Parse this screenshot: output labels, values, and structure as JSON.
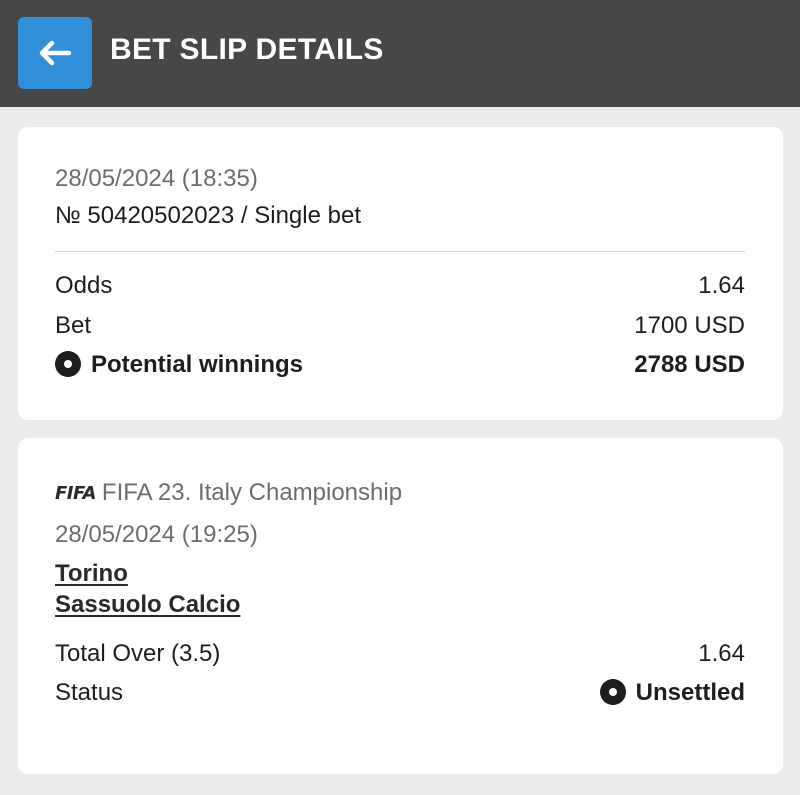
{
  "header": {
    "title": "BET SLIP DETAILS",
    "back_icon": "arrow-left-icon",
    "accent_color": "#2f8fd8",
    "bar_color": "#474747"
  },
  "summary": {
    "datetime": "28/05/2024 (18:35)",
    "ticket": "№ 50420502023 / Single bet",
    "odds_label": "Odds",
    "odds_value": "1.64",
    "bet_label": "Bet",
    "bet_value": "1700 USD",
    "winnings_label": "Potential winnings",
    "winnings_value": "2788 USD"
  },
  "event": {
    "league_logo": "FIFA",
    "league": "FIFA 23. Italy Championship",
    "datetime": "28/05/2024 (19:25)",
    "team_home": "Torino",
    "team_away": "Sassuolo Calcio",
    "market_label": "Total Over (3.5)",
    "market_odds": "1.64",
    "status_label": "Status",
    "status_value": "Unsettled"
  }
}
